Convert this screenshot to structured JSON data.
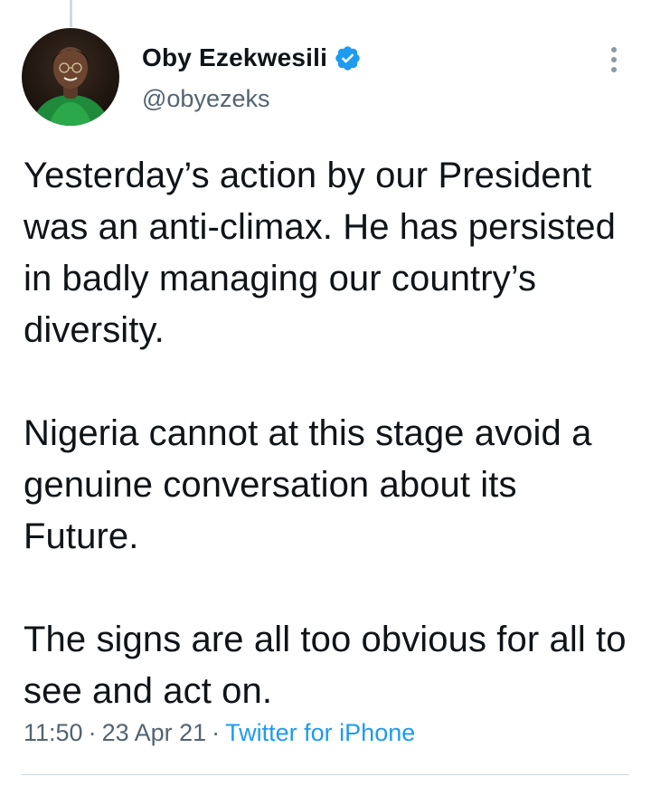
{
  "author": {
    "display_name": "Oby Ezekwesili",
    "handle": "@obyezeks",
    "verified": true,
    "avatar_icon": "profile-photo"
  },
  "tweet": {
    "paragraphs": [
      "Yesterday’s action by our President was an anti-climax. He has persisted in badly managing our country’s diversity.",
      "Nigeria cannot at this stage avoid a genuine conversation about its Future.",
      "The signs are all too obvious for all to see and act on."
    ]
  },
  "meta": {
    "time": "11:50",
    "separator": "·",
    "date": "23 Apr 21",
    "source": "Twitter for iPhone"
  },
  "colors": {
    "text_primary": "#0f1419",
    "text_secondary": "#536471",
    "accent": "#1d9bf0",
    "divider": "#cfd9de"
  },
  "icons": {
    "verified": "verified-badge-icon",
    "more": "more-vertical-icon"
  }
}
